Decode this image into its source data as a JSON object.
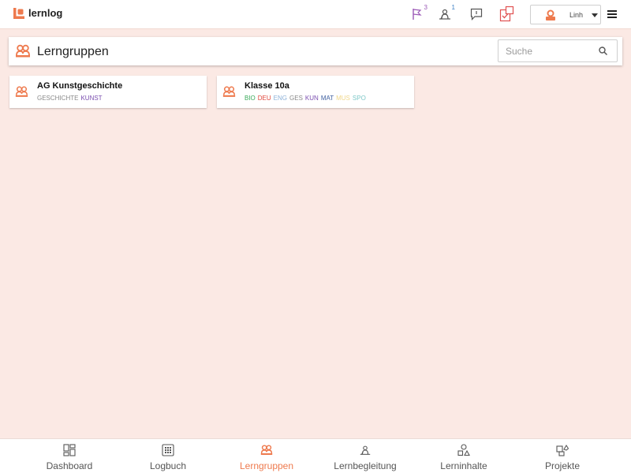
{
  "app": {
    "name": "lernlog",
    "accent": "#ee7a4e"
  },
  "topbar": {
    "notifications": [
      {
        "icon": "flag-icon",
        "count": "3",
        "color": "#9b59b6"
      },
      {
        "icon": "learning-support-icon",
        "count": "1",
        "color": "#3b7fc4"
      },
      {
        "icon": "message-icon",
        "count": "",
        "color": "#555555"
      },
      {
        "icon": "task-check-icon",
        "count": "",
        "color": "#e05050"
      }
    ],
    "user": {
      "name": "Linh"
    }
  },
  "header": {
    "title": "Lerngruppen",
    "search_placeholder": "Suche"
  },
  "groups": [
    {
      "title": "AG Kunstgeschichte",
      "subjects": [
        {
          "code": "GESCHICHTE",
          "color": "#8a8a8a"
        },
        {
          "code": "KUNST",
          "color": "#7b4fb0"
        }
      ]
    },
    {
      "title": "Klasse 10a",
      "subjects": [
        {
          "code": "BIO",
          "color": "#3aaa5a"
        },
        {
          "code": "DEU",
          "color": "#e0463a"
        },
        {
          "code": "ENG",
          "color": "#8db2d8"
        },
        {
          "code": "GES",
          "color": "#8a8a8a"
        },
        {
          "code": "KUN",
          "color": "#7b4fb0"
        },
        {
          "code": "MAT",
          "color": "#3f5f9f"
        },
        {
          "code": "MUS",
          "color": "#f0d78a"
        },
        {
          "code": "SPO",
          "color": "#7dc8c8"
        }
      ]
    }
  ],
  "bottom_nav": [
    {
      "label": "Dashboard",
      "icon": "dashboard-icon",
      "active": false
    },
    {
      "label": "Logbuch",
      "icon": "logbook-icon",
      "active": false
    },
    {
      "label": "Lerngruppen",
      "icon": "learning-groups-icon",
      "active": true
    },
    {
      "label": "Lernbegleitung",
      "icon": "learning-support-icon",
      "active": false
    },
    {
      "label": "Lerninhalte",
      "icon": "learning-content-icon",
      "active": false
    },
    {
      "label": "Projekte",
      "icon": "projects-icon",
      "active": false
    }
  ]
}
